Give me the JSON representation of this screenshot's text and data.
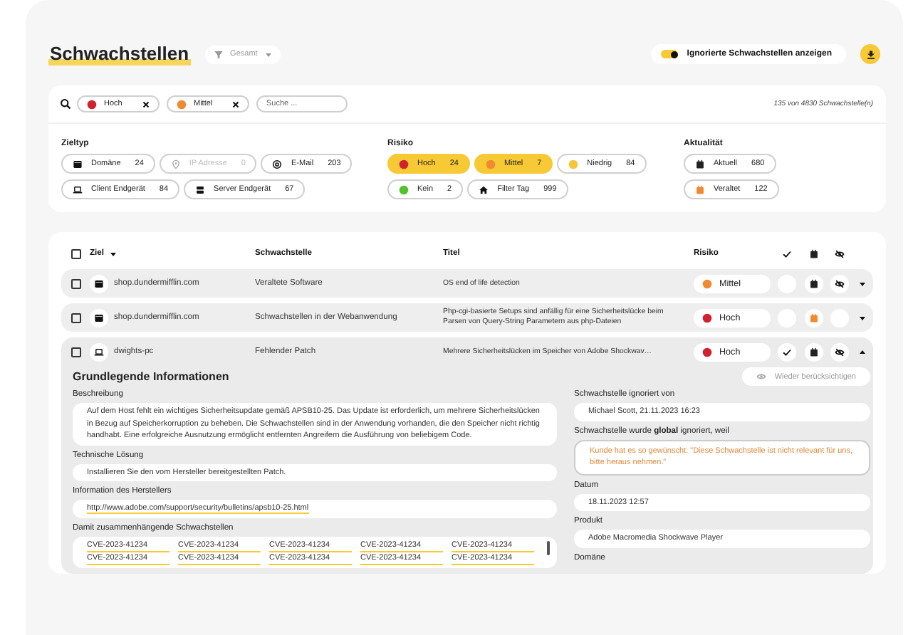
{
  "page": {
    "title": "Schwachstellen",
    "scope_dropdown": {
      "label": "Gesamt"
    },
    "ignored_toggle": {
      "label": "Ignorierte Schwachstellen anzeigen",
      "on": true
    }
  },
  "search": {
    "active_filters": [
      {
        "label": "Hoch",
        "color": "#d0222e"
      },
      {
        "label": "Mittel",
        "color": "#f08a30"
      }
    ],
    "placeholder": "Suche ...",
    "result_count": "135 von 4830 Schwachstelle(n)"
  },
  "filter_groups": [
    {
      "title": "Zieltyp",
      "chips": [
        {
          "kind": "domain",
          "label": "Domäne",
          "count": "24",
          "selected": false,
          "disabled": false
        },
        {
          "kind": "ip",
          "label": "IP Adresse",
          "count": "0",
          "selected": false,
          "disabled": true
        },
        {
          "kind": "email",
          "label": "E-Mail",
          "count": "203",
          "selected": false,
          "disabled": false
        },
        {
          "kind": "client",
          "label": "Client Endgerät",
          "count": "84",
          "selected": false,
          "disabled": false
        },
        {
          "kind": "server",
          "label": "Server Endgerät",
          "count": "67",
          "selected": false,
          "disabled": false
        }
      ]
    },
    {
      "title": "Risiko",
      "chips": [
        {
          "kind": "risk",
          "label": "Hoch",
          "count": "24",
          "color": "#d0222e",
          "selected": true,
          "disabled": false
        },
        {
          "kind": "risk",
          "label": "Mittel",
          "count": "7",
          "color": "#f08a30",
          "selected": true,
          "disabled": false
        },
        {
          "kind": "risk",
          "label": "Niedrig",
          "count": "84",
          "color": "#f5c63c",
          "selected": false,
          "disabled": false
        },
        {
          "kind": "risk",
          "label": "Kein",
          "count": "2",
          "color": "#56c02b",
          "selected": false,
          "disabled": false
        },
        {
          "kind": "tag",
          "label": "Filter Tag",
          "count": "999",
          "selected": false,
          "disabled": false
        }
      ]
    },
    {
      "title": "Aktualität",
      "chips": [
        {
          "kind": "current",
          "label": "Aktuell",
          "count": "680",
          "selected": false,
          "disabled": false
        },
        {
          "kind": "outdated",
          "label": "Veraltet",
          "count": "122",
          "selected": false,
          "disabled": false
        }
      ]
    }
  ],
  "table": {
    "select_all": {
      "checked": false
    },
    "columns": [
      {
        "label": "Ziel",
        "sorted": true
      },
      {
        "label": "Schwachstelle",
        "sorted": false
      },
      {
        "label": "Titel",
        "sorted": false
      },
      {
        "label": "Risiko",
        "sorted": false
      }
    ],
    "rows": [
      {
        "checked": false,
        "target": {
          "kind": "domain",
          "name": "shop.dundermifflin.com"
        },
        "vulnerability": "Veraltete Software",
        "title": "OS end of life detection",
        "risk": {
          "label": "Mittel",
          "color": "#f08a30"
        },
        "confirmed": false,
        "outdated": false,
        "ignored": true,
        "expanded": false
      },
      {
        "checked": false,
        "target": {
          "kind": "domain",
          "name": "shop.dundermifflin.com"
        },
        "vulnerability": "Schwachstellen in der Webanwendung",
        "title": "Php-cgi-basierte Setups sind anfällig für eine Sicherheitslücke beim Parsen von Query-String Parametern aus php-Dateien",
        "risk": {
          "label": "Hoch",
          "color": "#d0222e"
        },
        "confirmed": false,
        "outdated": true,
        "ignored": false,
        "expanded": false
      },
      {
        "checked": false,
        "target": {
          "kind": "client",
          "name": "dwights-pc"
        },
        "vulnerability": "Fehlender Patch",
        "title": "Mehrere Sicherheitslücken im Speicher von Adobe Shockwav…",
        "risk": {
          "label": "Hoch",
          "color": "#d0222e"
        },
        "confirmed": true,
        "outdated": false,
        "ignored": true,
        "expanded": true
      }
    ]
  },
  "detail": {
    "heading": "Grundlegende Informationen",
    "restore_button": "Wieder berücksichtigen",
    "left_fields": [
      {
        "kind": "text",
        "label": "Beschreibung",
        "value": "Auf dem Host fehlt ein wichtiges Sicherheitsupdate gemäß APSB10-25. Das Update ist erforderlich, um mehrere Sicherheitslücken in Bezug auf Speicherkorruption zu beheben. Die Schwachstellen sind in der Anwendung vorhanden, die den Speicher nicht richtig handhabt. Eine erfolgreiche Ausnutzung ermöglicht entfernten Angreifern die Ausführung von beliebigem Code."
      },
      {
        "kind": "text",
        "label": "Technische Lösung",
        "value": "Installieren Sie den vom Hersteller bereitgestellten Patch."
      },
      {
        "kind": "link",
        "label": "Information des Herstellers",
        "value": "http://www.adobe.com/support/security/bulletins/apsb10-25.html"
      },
      {
        "kind": "cve_list",
        "label": "Damit zusammenhängende Schwachstellen",
        "items": [
          "CVE-2023-41234",
          "CVE-2023-41234",
          "CVE-2023-41234",
          "CVE-2023-41234",
          "CVE-2023-41234",
          "CVE-2023-41234",
          "CVE-2023-41234",
          "CVE-2023-41234",
          "CVE-2023-41234",
          "CVE-2023-41234"
        ]
      }
    ],
    "right_fields": [
      {
        "kind": "text",
        "label": "Schwachstelle ignoriert von",
        "value": "Michael Scott, 21.11.2023  16:23"
      },
      {
        "kind": "reason",
        "label": "Schwachstelle wurde **global** ignoriert, weil",
        "value": "Kunde hat es so gewünscht: \"Diese Schwachstelle ist nicht relevant für uns, bitte heraus nehmen.\""
      },
      {
        "kind": "text",
        "label": "Datum",
        "value": "18.11.2023  12:57"
      },
      {
        "kind": "text",
        "label": "Produkt",
        "value": "Adobe Macromedia Shockwave Player"
      },
      {
        "kind": "text",
        "label": "Domäne"
      }
    ]
  }
}
